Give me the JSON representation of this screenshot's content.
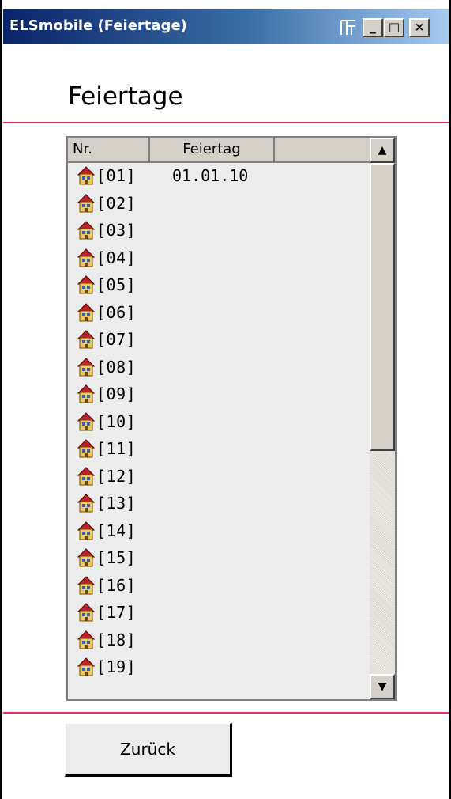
{
  "window": {
    "title": "ELSmobile (Feiertage)",
    "minimize_label": "_",
    "maximize_label": "□",
    "close_label": "×",
    "title_bar_color": "#0a246a"
  },
  "page": {
    "heading": "Feiertage",
    "accent_color": "#e0305a"
  },
  "list": {
    "columns": [
      "Nr.",
      "Feiertag",
      ""
    ],
    "rows": [
      {
        "nr": "[01]",
        "date": "01.01.10"
      },
      {
        "nr": "[02]",
        "date": ""
      },
      {
        "nr": "[03]",
        "date": ""
      },
      {
        "nr": "[04]",
        "date": ""
      },
      {
        "nr": "[05]",
        "date": ""
      },
      {
        "nr": "[06]",
        "date": ""
      },
      {
        "nr": "[07]",
        "date": ""
      },
      {
        "nr": "[08]",
        "date": ""
      },
      {
        "nr": "[09]",
        "date": ""
      },
      {
        "nr": "[10]",
        "date": ""
      },
      {
        "nr": "[11]",
        "date": ""
      },
      {
        "nr": "[12]",
        "date": ""
      },
      {
        "nr": "[13]",
        "date": ""
      },
      {
        "nr": "[14]",
        "date": ""
      },
      {
        "nr": "[15]",
        "date": ""
      },
      {
        "nr": "[16]",
        "date": ""
      },
      {
        "nr": "[17]",
        "date": ""
      },
      {
        "nr": "[18]",
        "date": ""
      },
      {
        "nr": "[19]",
        "date": ""
      }
    ],
    "row_icon": "house-icon",
    "scroll_up_label": "▲",
    "scroll_down_label": "▼"
  },
  "footer": {
    "back_label": "Zurück"
  }
}
